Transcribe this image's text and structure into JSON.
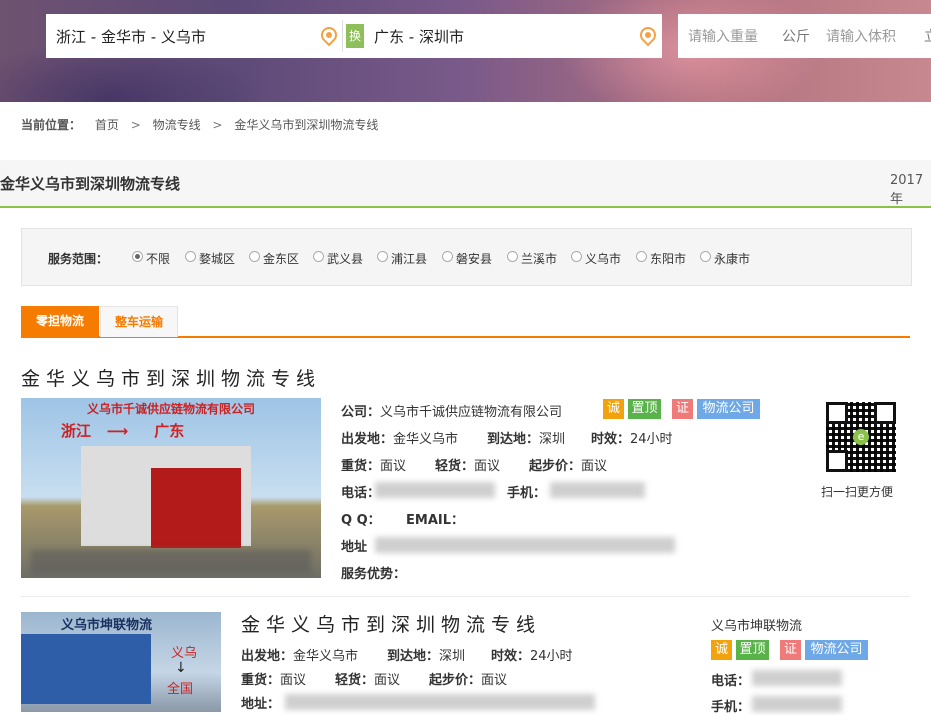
{
  "search": {
    "from": "浙江 - 金华市 - 义乌市",
    "to": "广东 - 深圳市",
    "swap": "换",
    "weight_placeholder": "请输入重量",
    "weight_unit": "公斤",
    "volume_placeholder": "请输入体积",
    "volume_unit_partial": "立"
  },
  "breadcrumb": {
    "label": "当前位置：",
    "items": [
      "首页",
      "物流专线",
      "金华义乌市到深圳物流专线"
    ],
    "sep": ">"
  },
  "page": {
    "title": "金华义乌市到深圳物流专线",
    "date_partial": "2017年"
  },
  "filter": {
    "label": "服务范围：",
    "options": [
      "不限",
      "婺城区",
      "金东区",
      "武义县",
      "浦江县",
      "磐安县",
      "兰溪市",
      "义乌市",
      "东阳市",
      "永康市"
    ],
    "selected": "不限"
  },
  "tabs": [
    "零担物流",
    "整车运输"
  ],
  "listings": [
    {
      "title": "金华义乌市到深圳物流专线",
      "image_caption": "义乌市千诚供应链物流有限公司",
      "image_route_from": "浙江",
      "image_route_to": "广东",
      "company_label": "公司：",
      "company": "义乌市千诚供应链物流有限公司",
      "badges": [
        "诚",
        "置顶",
        "证",
        "物流公司"
      ],
      "origin_label": "出发地：",
      "origin": "金华义乌市",
      "dest_label": "到达地：",
      "dest": "深圳",
      "time_label": "时效：",
      "time": "24小时",
      "heavy_label": "重货：",
      "heavy": "面议",
      "light_label": "轻货：",
      "light": "面议",
      "min_label": "起步价：",
      "min": "面议",
      "phone_label": "电话：",
      "mobile_label": "手机：",
      "qq_label": "Q Q：",
      "email_label": "EMAIL：",
      "address_label": "地址",
      "advantage_label": "服务优势：",
      "qr_caption": "扫一扫更方便"
    },
    {
      "title": "金华义乌市到深圳物流专线",
      "image_caption": "义乌市坤联物流",
      "image_dest1": "义乌",
      "image_arrow": "↓",
      "image_dest2": "全国",
      "company": "义乌市坤联物流",
      "badges": [
        "诚",
        "置顶",
        "证",
        "物流公司"
      ],
      "origin_label": "出发地：",
      "origin": "金华义乌市",
      "dest_label": "到达地：",
      "dest": "深圳",
      "time_label": "时效：",
      "time": "24小时",
      "heavy_label": "重货：",
      "heavy": "面议",
      "light_label": "轻货：",
      "light": "面议",
      "min_label": "起步价：",
      "min": "面议",
      "address_label": "地址：",
      "phone_label": "电话：",
      "mobile_label": "手机："
    }
  ]
}
